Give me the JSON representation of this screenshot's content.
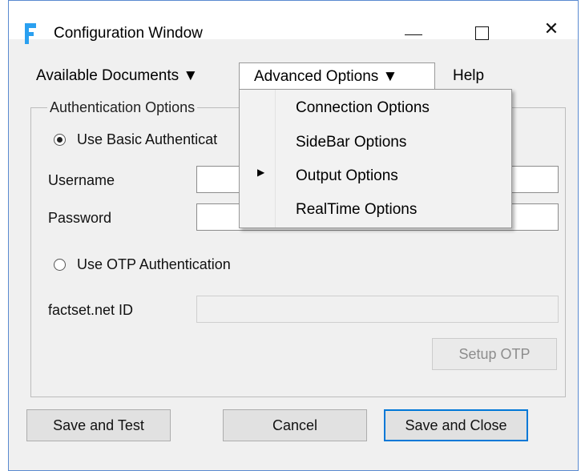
{
  "window": {
    "title": "Configuration Window",
    "controls": {
      "minimize": "—",
      "maximize": "☐",
      "close": "✕"
    }
  },
  "menubar": {
    "items": [
      {
        "label": "Available Documents ▼"
      },
      {
        "label": "Advanced Options ▼"
      },
      {
        "label": "Help"
      }
    ]
  },
  "dropdown": {
    "items": [
      {
        "label": "Connection Options"
      },
      {
        "label": "SideBar Options"
      },
      {
        "label": "Output Options"
      },
      {
        "label": "RealTime Options"
      }
    ],
    "submenu_arrow": "▶"
  },
  "auth": {
    "group_label": "Authentication Options",
    "basic_label": "Use Basic Authenticat",
    "username_label": "Username",
    "username_value": "",
    "password_label": "Password",
    "password_value": "",
    "otp_label": "Use OTP Authentication",
    "factset_label": "factset.net ID",
    "factset_value": "",
    "setup_otp": "Setup OTP",
    "selected": "basic"
  },
  "buttons": {
    "save_test": "Save and Test",
    "cancel": "Cancel",
    "save_close": "Save and Close"
  },
  "colors": {
    "accent": "#0078d7",
    "icon": "#2aa0f0",
    "window_bg": "#f0f0f0"
  }
}
